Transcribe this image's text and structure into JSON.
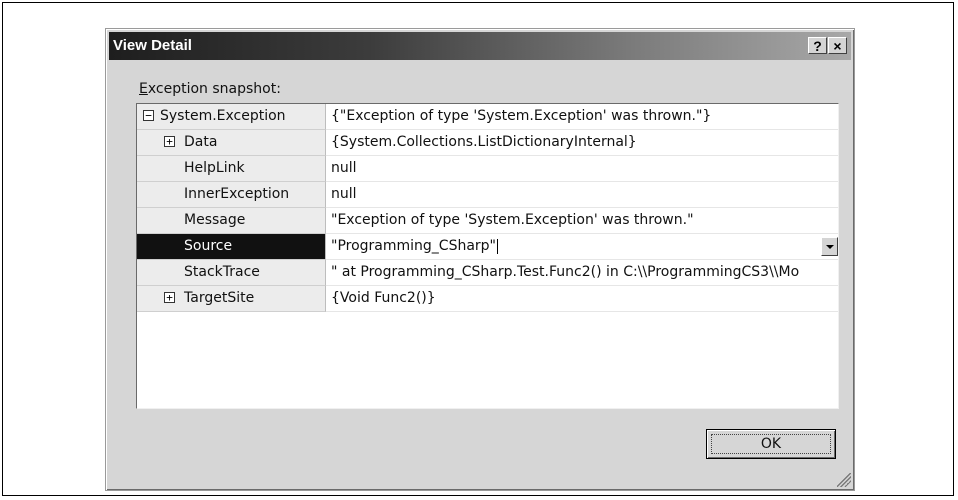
{
  "dialog": {
    "title": "View Detail",
    "help_button": "?",
    "close_button": "×",
    "snapshot_label_accel": "E",
    "snapshot_label_rest": "xception snapshot:",
    "ok_label": "OK"
  },
  "rows": [
    {
      "name": "System.Exception",
      "value": "{\"Exception of type 'System.Exception' was thrown.\"}",
      "expander": "⊟"
    },
    {
      "name": "Data",
      "value": "{System.Collections.ListDictionaryInternal}",
      "expander": "⊞"
    },
    {
      "name": "HelpLink",
      "value": "null",
      "expander": ""
    },
    {
      "name": "InnerException",
      "value": "null",
      "expander": ""
    },
    {
      "name": "Message",
      "value": "\"Exception of type 'System.Exception' was thrown.\"",
      "expander": ""
    },
    {
      "name": "Source",
      "value": "\"Programming_CSharp\"",
      "expander": ""
    },
    {
      "name": "StackTrace",
      "value": "\"    at Programming_CSharp.Test.Func2() in C:\\\\ProgrammingCS3\\\\Mo",
      "expander": ""
    },
    {
      "name": "TargetSite",
      "value": "{Void Func2()}",
      "expander": "⊞"
    }
  ],
  "selected_row": "Source",
  "colors": {
    "dialog_bg": "#d6d6d6",
    "selected_bg": "#111111",
    "name_col_bg": "#ececec"
  }
}
